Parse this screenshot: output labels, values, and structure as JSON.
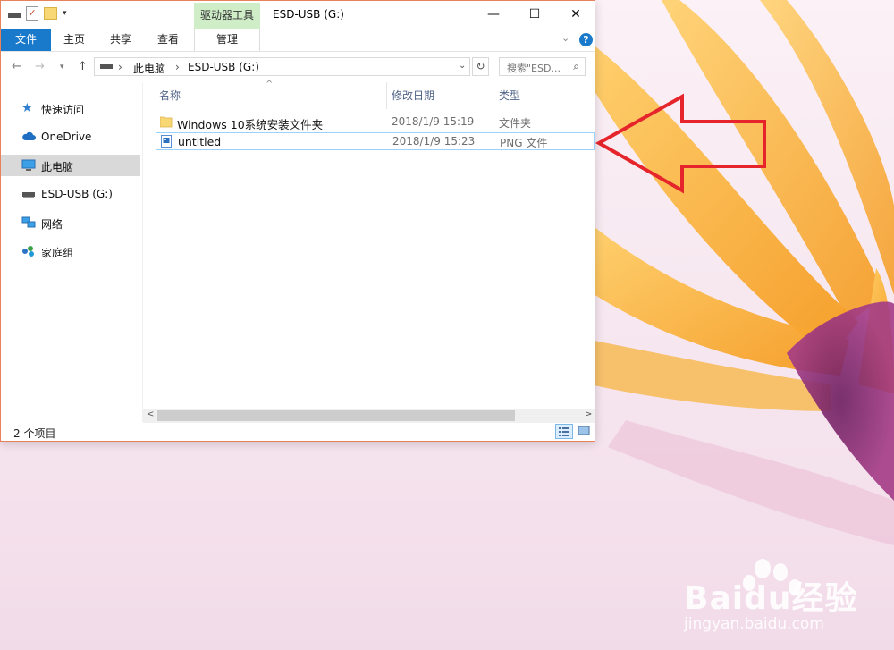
{
  "window": {
    "title": "ESD-USB (G:)",
    "context_tab_group": "驱动器工具",
    "buttons": {
      "minimize": "—",
      "maximize": "☐",
      "close": "✕"
    }
  },
  "ribbon": {
    "tabs": [
      "文件",
      "主页",
      "共享",
      "查看",
      "管理"
    ],
    "help": "?"
  },
  "address_bar": {
    "path": [
      "此电脑",
      "ESD-USB (G:)"
    ],
    "search_placeholder": "搜索\"ESD..."
  },
  "sidebar": {
    "items": [
      {
        "label": "快速访问",
        "icon": "star-icon"
      },
      {
        "label": "OneDrive",
        "icon": "cloud-icon"
      },
      {
        "label": "此电脑",
        "icon": "computer-icon",
        "selected": true
      },
      {
        "label": "ESD-USB (G:)",
        "icon": "usb-drive-icon"
      },
      {
        "label": "网络",
        "icon": "network-icon"
      },
      {
        "label": "家庭组",
        "icon": "homegroup-icon"
      }
    ]
  },
  "file_list": {
    "columns": [
      "名称",
      "修改日期",
      "类型"
    ],
    "rows": [
      {
        "name": "Windows 10系统安装文件夹",
        "date": "2018/1/9 15:19",
        "type": "文件夹",
        "icon": "folder-icon"
      },
      {
        "name": "untitled",
        "date": "2018/1/9 15:23",
        "type": "PNG 文件",
        "icon": "png-file-icon",
        "selected": true
      }
    ]
  },
  "status": {
    "item_count": "2 个项目"
  },
  "watermark": {
    "brand": "Baidu经验",
    "url": "jingyan.baidu.com"
  },
  "colors": {
    "accent": "#1979ca",
    "annotation_arrow": "#e5242b",
    "petal": "#f8b13c"
  }
}
